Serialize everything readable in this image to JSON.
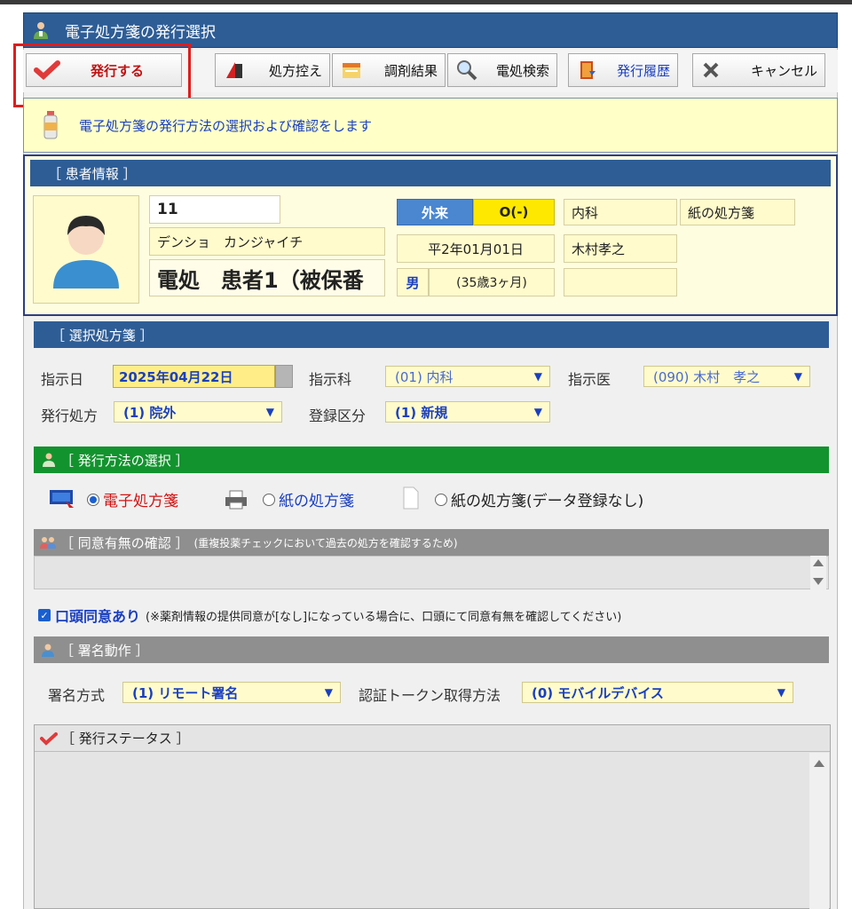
{
  "window": {
    "title": "電子処方箋の発行選択"
  },
  "toolbar": {
    "issue": "発行する",
    "copy": "処方控え",
    "dispense": "調剤結果",
    "search": "電処検索",
    "history": "発行履歴",
    "cancel": "キャンセル"
  },
  "info": {
    "message": "電子処方箋の発行方法の選択および確認をします"
  },
  "patient": {
    "section": "［ 患者情報 ］",
    "id": "11",
    "kana": "デンショ　カンジャイチ",
    "name": "電処　患者1（被保番",
    "visit_type": "外来",
    "visit_code": "O(-)",
    "department": "内科",
    "prescription_kind": "紙の処方箋",
    "birthdate": "平2年01月01日",
    "doctor": "木村孝之",
    "sex": "男",
    "age": "(35歳3ヶ月)"
  },
  "selected": {
    "section": "［ 選択処方箋 ］",
    "date_label": "指示日",
    "date": "2025年04月22日",
    "dept_label": "指示科",
    "dept": "(01) 内科",
    "doctor_label": "指示医",
    "doctor": "(090) 木村　孝之",
    "issue_label": "発行処方",
    "issue": "(1) 院外",
    "reg_label": "登録区分",
    "reg": "(1) 新規"
  },
  "method": {
    "section": "［ 発行方法の選択 ］",
    "opt_electronic": "電子処方箋",
    "opt_paper": "紙の処方箋",
    "opt_paper_nodata": "紙の処方箋(データ登録なし)"
  },
  "consent": {
    "section": "［ 同意有無の確認 ］",
    "note": "(重複投薬チェックにおいて過去の処方を確認するため)",
    "checkbox_label": "口頭同意あり",
    "checkbox_note": "(※薬剤情報の提供同意が[なし]になっている場合に、口頭にて同意有無を確認してください)"
  },
  "signature": {
    "section": "［ 署名動作 ］",
    "method_label": "署名方式",
    "method": "(1) リモート署名",
    "token_label": "認証トークン取得方法",
    "token": "(0) モバイルデバイス"
  },
  "status": {
    "section": "［ 発行ステータス ］"
  },
  "colors": {
    "title_bar": "#2e5d96",
    "green_section": "#12932e",
    "gray_section": "#8f8f8f",
    "info_bg": "#ffffc8",
    "field_bg": "#fffbcc",
    "highlight": "#e01c1c"
  }
}
